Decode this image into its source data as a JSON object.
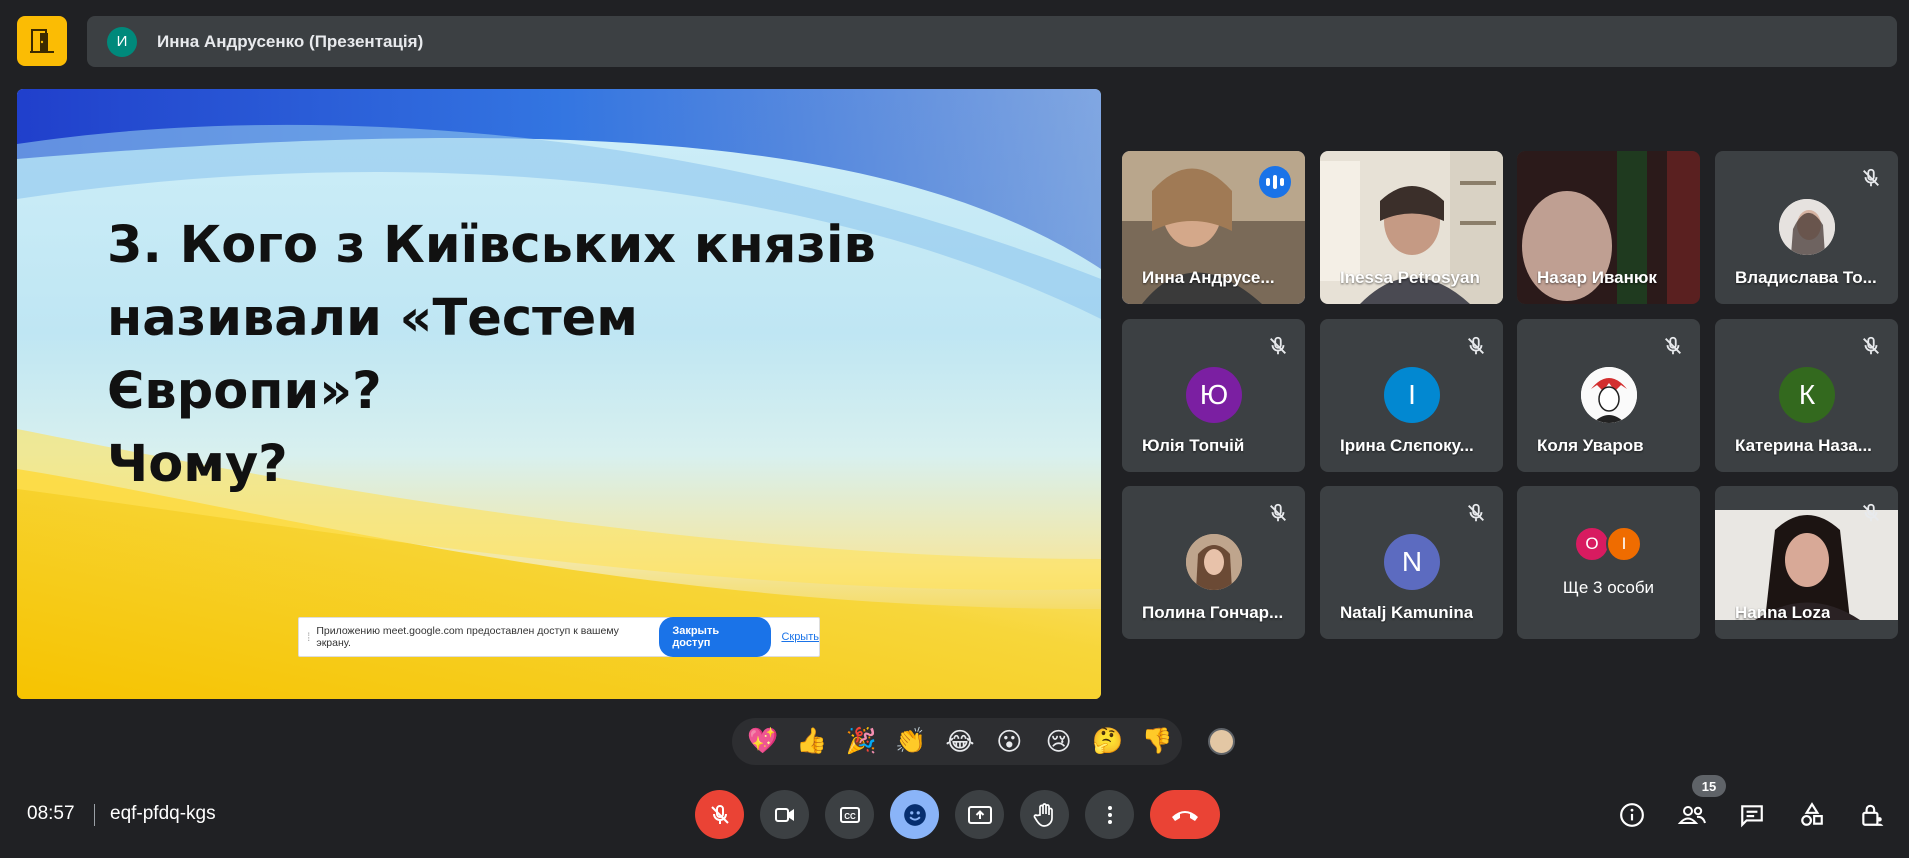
{
  "topbar": {
    "avatar_letter": "И",
    "presenter": "Инна Андрусенко (Презентація)"
  },
  "slide": {
    "line1": "3. Кого з Київських князів",
    "line2": "називали «Тестем Європи»?",
    "line3": "Чому?"
  },
  "share_bar": {
    "message": "Приложению meet.google.com предоставлен доступ к вашему экрану.",
    "stop_label": "Закрыть доступ",
    "hide_label": "Скрыть"
  },
  "participants": [
    {
      "name": "Инна Андрусенко",
      "display": "Инна Андрусе...",
      "speaking": true
    },
    {
      "name": "Inessa Petrosyan",
      "display": "Inessa Petrosyan"
    },
    {
      "name": "Назар Иванюк",
      "display": "Назар Иванюк"
    },
    {
      "name": "Владислава То...",
      "display": "Владислава То...",
      "muted": true
    },
    {
      "name": "Юлія Топчій",
      "display": "Юлія Топчій",
      "initial": "Ю",
      "color": "#7b1fa2",
      "muted": true
    },
    {
      "name": "Ірина Слєпоку...",
      "display": "Ірина Слєпоку...",
      "initial": "І",
      "color": "#0288d1",
      "muted": true
    },
    {
      "name": "Коля Уваров",
      "display": "Коля Уваров",
      "muted": true
    },
    {
      "name": "Катерина Наза...",
      "display": "Катерина Наза...",
      "initial": "К",
      "color": "#33691e",
      "muted": true
    },
    {
      "name": "Полина Гончар...",
      "display": "Полина Гончар...",
      "muted": true
    },
    {
      "name": "Natalj Kamunina",
      "display": "Natalj Kamunina",
      "initial": "N",
      "color": "#5c6bc0",
      "muted": true
    },
    {
      "name": "Hanna Loza",
      "display": "Hanna Loza",
      "muted": true
    }
  ],
  "more": {
    "label": "Ще 3 особи",
    "initials": [
      "О",
      "І"
    ],
    "colors": [
      "#d81b60",
      "#ef6c00"
    ]
  },
  "reactions": [
    "💖",
    "👍",
    "🎉",
    "👏",
    "😂",
    "😮",
    "😢",
    "🤔",
    "👎"
  ],
  "footer": {
    "time": "08:57",
    "meeting_code": "eqf-pfdq-kgs",
    "participant_count": "15"
  },
  "colors": {
    "accent": "#8ab4f8",
    "danger": "#ea4335",
    "logo": "#fbbc04"
  }
}
